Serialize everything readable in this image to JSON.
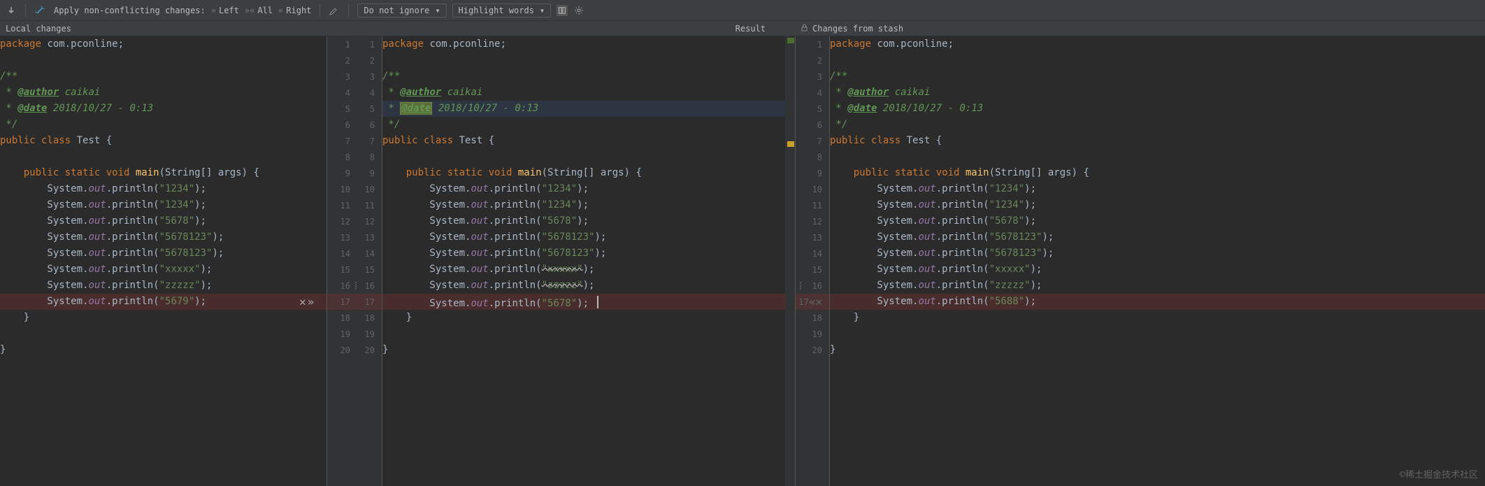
{
  "toolbar": {
    "apply_label": "Apply non-conflicting changes:",
    "left_btn": "Left",
    "all_btn": "All",
    "right_btn": "Right",
    "ignore_combo": "Do not ignore",
    "highlight_combo": "Highlight words"
  },
  "headers": {
    "left": "Local changes",
    "mid": "Result",
    "right": "Changes from stash"
  },
  "lines_left": [
    {
      "n": 1,
      "segs": [
        [
          "kw",
          "package "
        ],
        [
          "pkg",
          "com.pconline"
        ],
        [
          "pun",
          ";"
        ]
      ]
    },
    {
      "n": 2,
      "segs": []
    },
    {
      "n": 3,
      "segs": [
        [
          "doc",
          "/**"
        ]
      ]
    },
    {
      "n": 4,
      "segs": [
        [
          "doc",
          " * "
        ],
        [
          "doc-tag",
          "@author"
        ],
        [
          "doc",
          " caikai"
        ]
      ]
    },
    {
      "n": 5,
      "segs": [
        [
          "doc",
          " * "
        ],
        [
          "doc-tag",
          "@date"
        ],
        [
          "doc",
          " 2018/10/27 - 0:13"
        ]
      ]
    },
    {
      "n": 6,
      "segs": [
        [
          "doc",
          " */"
        ]
      ]
    },
    {
      "n": 7,
      "segs": [
        [
          "kw",
          "public class "
        ],
        [
          "cls",
          "Test {"
        ]
      ]
    },
    {
      "n": 8,
      "segs": []
    },
    {
      "n": 9,
      "segs": [
        [
          "pun",
          "    "
        ],
        [
          "kw",
          "public static void "
        ],
        [
          "mth",
          "main"
        ],
        [
          "pun",
          "(String[] args) {"
        ]
      ]
    },
    {
      "n": 10,
      "segs": [
        [
          "pun",
          "        System."
        ],
        [
          "fld",
          "out"
        ],
        [
          "pun",
          ".println("
        ],
        [
          "str",
          "\"1234\""
        ],
        [
          "pun",
          ");"
        ]
      ]
    },
    {
      "n": 11,
      "segs": [
        [
          "pun",
          "        System."
        ],
        [
          "fld",
          "out"
        ],
        [
          "pun",
          ".println("
        ],
        [
          "str",
          "\"1234\""
        ],
        [
          "pun",
          ");"
        ]
      ]
    },
    {
      "n": 12,
      "segs": [
        [
          "pun",
          "        System."
        ],
        [
          "fld",
          "out"
        ],
        [
          "pun",
          ".println("
        ],
        [
          "str",
          "\"5678\""
        ],
        [
          "pun",
          ");"
        ]
      ]
    },
    {
      "n": 13,
      "segs": [
        [
          "pun",
          "        System."
        ],
        [
          "fld",
          "out"
        ],
        [
          "pun",
          ".println("
        ],
        [
          "str",
          "\"5678123\""
        ],
        [
          "pun",
          ");"
        ]
      ]
    },
    {
      "n": 14,
      "segs": [
        [
          "pun",
          "        System."
        ],
        [
          "fld",
          "out"
        ],
        [
          "pun",
          ".println("
        ],
        [
          "str",
          "\"5678123\""
        ],
        [
          "pun",
          ");"
        ]
      ]
    },
    {
      "n": 15,
      "segs": [
        [
          "pun",
          "        System."
        ],
        [
          "fld",
          "out"
        ],
        [
          "pun",
          ".println("
        ],
        [
          "str",
          "\"xxxxx\""
        ],
        [
          "pun",
          ");"
        ]
      ]
    },
    {
      "n": 16,
      "segs": [
        [
          "pun",
          "        System."
        ],
        [
          "fld",
          "out"
        ],
        [
          "pun",
          ".println("
        ],
        [
          "str",
          "\"zzzzz\""
        ],
        [
          "pun",
          ");"
        ]
      ]
    },
    {
      "n": 17,
      "diff": "conflict",
      "segs": [
        [
          "pun",
          "        System."
        ],
        [
          "fld",
          "out"
        ],
        [
          "pun",
          ".println("
        ],
        [
          "str",
          "\"5679\""
        ],
        [
          "pun",
          ");"
        ]
      ]
    },
    {
      "n": 18,
      "segs": [
        [
          "pun",
          "    }"
        ]
      ]
    },
    {
      "n": 19,
      "segs": []
    },
    {
      "n": 20,
      "segs": [
        [
          "pun",
          "}"
        ]
      ]
    }
  ],
  "lines_mid": [
    {
      "n": 1,
      "segs": [
        [
          "kw",
          "package "
        ],
        [
          "pkg",
          "com.pconline"
        ],
        [
          "pun",
          ";"
        ]
      ]
    },
    {
      "n": 2,
      "segs": []
    },
    {
      "n": 3,
      "segs": [
        [
          "doc",
          "/**"
        ]
      ]
    },
    {
      "n": 4,
      "segs": [
        [
          "doc",
          " * "
        ],
        [
          "doc-tag",
          "@author"
        ],
        [
          "doc",
          " caikai"
        ]
      ]
    },
    {
      "n": 5,
      "diff": "mod",
      "segs": [
        [
          "doc",
          " * "
        ],
        [
          "doc-tag hl",
          "@date"
        ],
        [
          "doc",
          " 2018/10/27 - 0:13"
        ]
      ]
    },
    {
      "n": 6,
      "segs": [
        [
          "doc",
          " */"
        ]
      ]
    },
    {
      "n": 7,
      "segs": [
        [
          "kw",
          "public class "
        ],
        [
          "cls",
          "Test {"
        ]
      ]
    },
    {
      "n": 8,
      "segs": []
    },
    {
      "n": 9,
      "segs": [
        [
          "pun",
          "    "
        ],
        [
          "kw",
          "public static void "
        ],
        [
          "mth",
          "main"
        ],
        [
          "pun",
          "(String[] args) {"
        ]
      ]
    },
    {
      "n": 10,
      "segs": [
        [
          "pun",
          "        System."
        ],
        [
          "fld",
          "out"
        ],
        [
          "pun",
          ".println("
        ],
        [
          "str",
          "\"1234\""
        ],
        [
          "pun",
          ");"
        ]
      ]
    },
    {
      "n": 11,
      "segs": [
        [
          "pun",
          "        System."
        ],
        [
          "fld",
          "out"
        ],
        [
          "pun",
          ".println("
        ],
        [
          "str",
          "\"1234\""
        ],
        [
          "pun",
          ");"
        ]
      ]
    },
    {
      "n": 12,
      "segs": [
        [
          "pun",
          "        System."
        ],
        [
          "fld",
          "out"
        ],
        [
          "pun",
          ".println("
        ],
        [
          "str",
          "\"5678\""
        ],
        [
          "pun",
          ");"
        ]
      ]
    },
    {
      "n": 13,
      "segs": [
        [
          "pun",
          "        System."
        ],
        [
          "fld",
          "out"
        ],
        [
          "pun",
          ".println("
        ],
        [
          "str",
          "\"5678123\""
        ],
        [
          "pun",
          ");"
        ]
      ]
    },
    {
      "n": 14,
      "segs": [
        [
          "pun",
          "        System."
        ],
        [
          "fld",
          "out"
        ],
        [
          "pun",
          ".println("
        ],
        [
          "str",
          "\"5678123\""
        ],
        [
          "pun",
          ");"
        ]
      ]
    },
    {
      "n": 15,
      "segs": [
        [
          "pun",
          "        System."
        ],
        [
          "fld",
          "out"
        ],
        [
          "pun",
          ".println("
        ],
        [
          "str strike",
          "\"xxxxx\""
        ],
        [
          "pun",
          ");"
        ]
      ]
    },
    {
      "n": 16,
      "segs": [
        [
          "pun",
          "        System."
        ],
        [
          "fld",
          "out"
        ],
        [
          "pun",
          ".println("
        ],
        [
          "str strike",
          "\"zzzzz\""
        ],
        [
          "pun",
          ");"
        ]
      ]
    },
    {
      "n": 17,
      "diff": "conflict",
      "segs": [
        [
          "pun",
          "        System."
        ],
        [
          "fld",
          "out"
        ],
        [
          "pun",
          ".println("
        ],
        [
          "str",
          "\"5678\""
        ],
        [
          "pun",
          ");"
        ]
      ],
      "cursor": true
    },
    {
      "n": 18,
      "segs": [
        [
          "pun",
          "    }"
        ]
      ]
    },
    {
      "n": 19,
      "segs": []
    },
    {
      "n": 20,
      "segs": [
        [
          "pun",
          "}"
        ]
      ]
    }
  ],
  "lines_right": [
    {
      "n": 1,
      "segs": [
        [
          "kw",
          "package "
        ],
        [
          "pkg",
          "com.pconline"
        ],
        [
          "pun",
          ";"
        ]
      ]
    },
    {
      "n": 2,
      "segs": []
    },
    {
      "n": 3,
      "segs": [
        [
          "doc",
          "/**"
        ]
      ]
    },
    {
      "n": 4,
      "segs": [
        [
          "doc",
          " * "
        ],
        [
          "doc-tag",
          "@author"
        ],
        [
          "doc",
          " caikai"
        ]
      ]
    },
    {
      "n": 5,
      "segs": [
        [
          "doc",
          " * "
        ],
        [
          "doc-tag",
          "@date"
        ],
        [
          "doc",
          " 2018/10/27 - 0:13"
        ]
      ]
    },
    {
      "n": 6,
      "segs": [
        [
          "doc",
          " */"
        ]
      ]
    },
    {
      "n": 7,
      "segs": [
        [
          "kw",
          "public class "
        ],
        [
          "cls",
          "Test {"
        ]
      ]
    },
    {
      "n": 8,
      "segs": []
    },
    {
      "n": 9,
      "segs": [
        [
          "pun",
          "    "
        ],
        [
          "kw",
          "public static void "
        ],
        [
          "mth",
          "main"
        ],
        [
          "pun",
          "(String[] args) {"
        ]
      ]
    },
    {
      "n": 10,
      "segs": [
        [
          "pun",
          "        System."
        ],
        [
          "fld",
          "out"
        ],
        [
          "pun",
          ".println("
        ],
        [
          "str",
          "\"1234\""
        ],
        [
          "pun",
          ");"
        ]
      ]
    },
    {
      "n": 11,
      "segs": [
        [
          "pun",
          "        System."
        ],
        [
          "fld",
          "out"
        ],
        [
          "pun",
          ".println("
        ],
        [
          "str",
          "\"1234\""
        ],
        [
          "pun",
          ");"
        ]
      ]
    },
    {
      "n": 12,
      "segs": [
        [
          "pun",
          "        System."
        ],
        [
          "fld",
          "out"
        ],
        [
          "pun",
          ".println("
        ],
        [
          "str",
          "\"5678\""
        ],
        [
          "pun",
          ");"
        ]
      ]
    },
    {
      "n": 13,
      "segs": [
        [
          "pun",
          "        System."
        ],
        [
          "fld",
          "out"
        ],
        [
          "pun",
          ".println("
        ],
        [
          "str",
          "\"5678123\""
        ],
        [
          "pun",
          ");"
        ]
      ]
    },
    {
      "n": 14,
      "segs": [
        [
          "pun",
          "        System."
        ],
        [
          "fld",
          "out"
        ],
        [
          "pun",
          ".println("
        ],
        [
          "str",
          "\"5678123\""
        ],
        [
          "pun",
          ");"
        ]
      ]
    },
    {
      "n": 15,
      "segs": [
        [
          "pun",
          "        System."
        ],
        [
          "fld",
          "out"
        ],
        [
          "pun",
          ".println("
        ],
        [
          "str",
          "\"xxxxx\""
        ],
        [
          "pun",
          ");"
        ]
      ]
    },
    {
      "n": 16,
      "segs": [
        [
          "pun",
          "        System."
        ],
        [
          "fld",
          "out"
        ],
        [
          "pun",
          ".println("
        ],
        [
          "str",
          "\"zzzzz\""
        ],
        [
          "pun",
          ");"
        ]
      ]
    },
    {
      "n": 17,
      "diff": "conflict",
      "segs": [
        [
          "pun",
          "        System."
        ],
        [
          "fld",
          "out"
        ],
        [
          "pun",
          ".println("
        ],
        [
          "str",
          "\"5688\""
        ],
        [
          "pun",
          ");"
        ]
      ]
    },
    {
      "n": 18,
      "segs": [
        [
          "pun",
          "    }"
        ]
      ]
    },
    {
      "n": 19,
      "segs": []
    },
    {
      "n": 20,
      "segs": [
        [
          "pun",
          "}"
        ]
      ]
    }
  ],
  "gutter_left": {
    "rows": [
      1,
      2,
      3,
      4,
      5,
      6,
      7,
      8,
      9,
      10,
      11,
      12,
      13,
      14,
      15,
      16,
      17,
      18,
      19,
      20
    ],
    "actions": {
      "17": [
        "reject",
        "accept-right"
      ]
    }
  },
  "gutter_right_single": {
    "rows": [
      1,
      2,
      3,
      4,
      5,
      6,
      7,
      8,
      9,
      10,
      11,
      12,
      13,
      14,
      15,
      16,
      17,
      18,
      19,
      20
    ],
    "actions": {
      "17": [
        "accept-left",
        "reject"
      ]
    }
  },
  "watermark": "©稀土掘金技术社区"
}
